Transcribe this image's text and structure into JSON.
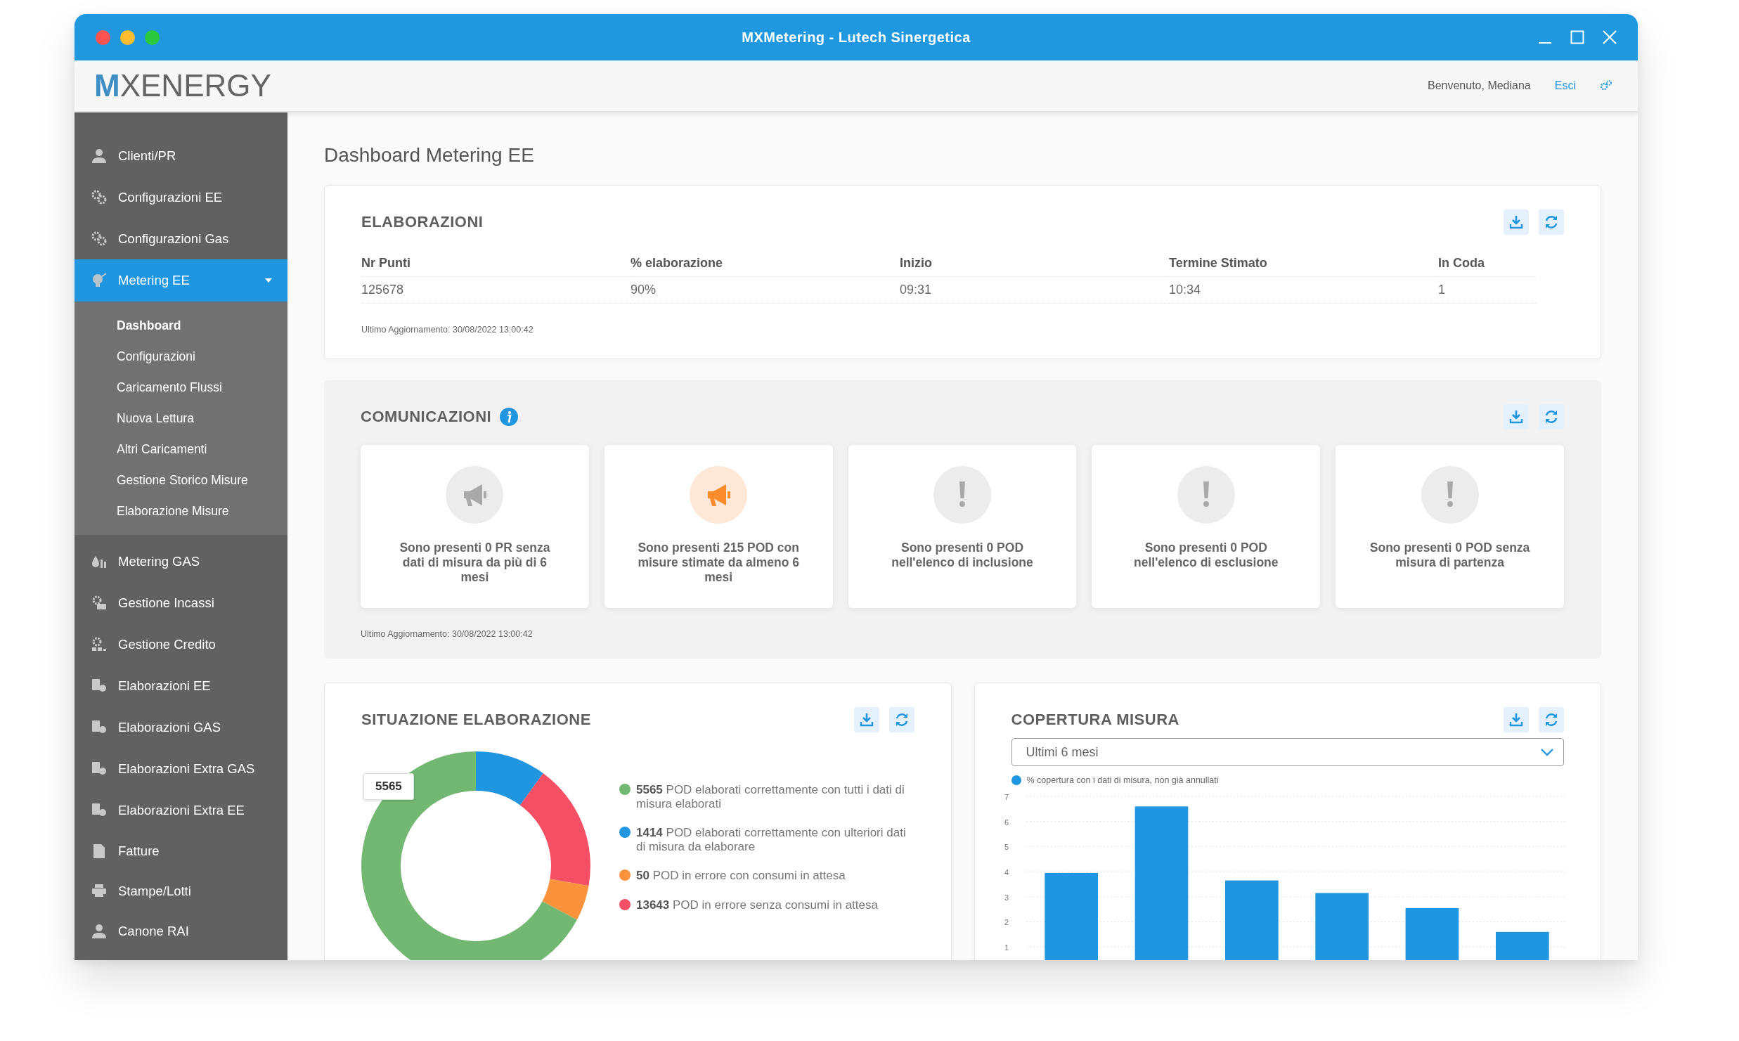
{
  "window": {
    "title": "MXMetering - Lutech Sinergetica"
  },
  "header": {
    "logo": {
      "mark": "M",
      "text": "XENERGY"
    },
    "welcome": "Benvenuto, Mediana",
    "logout": "Esci"
  },
  "sidebar": {
    "items": [
      {
        "label": "Clienti/PR",
        "selected": false
      },
      {
        "label": "Configurazioni EE",
        "selected": false
      },
      {
        "label": "Configurazioni Gas",
        "selected": false
      },
      {
        "label": "Metering EE",
        "selected": true,
        "expanded": true,
        "children": [
          {
            "label": "Dashboard",
            "selected": true
          },
          {
            "label": "Configurazioni",
            "selected": false
          },
          {
            "label": "Caricamento Flussi",
            "selected": false
          },
          {
            "label": "Nuova Lettura",
            "selected": false
          },
          {
            "label": "Altri Caricamenti",
            "selected": false
          },
          {
            "label": "Gestione Storico Misure",
            "selected": false
          },
          {
            "label": "Elaborazione Misure",
            "selected": false
          }
        ]
      },
      {
        "label": "Metering GAS",
        "selected": false
      },
      {
        "label": "Gestione Incassi",
        "selected": false
      },
      {
        "label": "Gestione Credito",
        "selected": false
      },
      {
        "label": "Elaborazioni EE",
        "selected": false
      },
      {
        "label": "Elaborazioni GAS",
        "selected": false
      },
      {
        "label": "Elaborazioni Extra GAS",
        "selected": false
      },
      {
        "label": "Elaborazioni Extra EE",
        "selected": false
      },
      {
        "label": "Fatture",
        "selected": false
      },
      {
        "label": "Stampe/Lotti",
        "selected": false
      },
      {
        "label": "Canone RAI",
        "selected": false
      }
    ]
  },
  "page_title": "Dashboard Metering EE",
  "elaborazioni": {
    "title": "ELABORAZIONI",
    "table": {
      "columns": [
        "Nr Punti",
        "% elaborazione",
        "Inizio",
        "Termine Stimato",
        "In Coda"
      ],
      "rows": [
        [
          "125678",
          "90%",
          "09:31",
          "10:34",
          "1"
        ]
      ]
    },
    "updated": "Ultimo Aggiornamento: 30/08/2022 13:00:42"
  },
  "comunicazioni": {
    "title": "COMUNICAZIONI",
    "cards": [
      {
        "kind": "megaphone",
        "active": false,
        "text": "Sono presenti 0 PR senza dati di misura da più di 6 mesi"
      },
      {
        "kind": "megaphone",
        "active": true,
        "text": "Sono presenti 215 POD con misure stimate da almeno 6 mesi"
      },
      {
        "kind": "alert",
        "active": false,
        "text": "Sono presenti 0 POD nell'elenco di inclusione"
      },
      {
        "kind": "alert",
        "active": false,
        "text": "Sono presenti 0 POD nell'elenco di esclusione"
      },
      {
        "kind": "alert",
        "active": false,
        "text": "Sono presenti 0 POD senza misura di partenza"
      }
    ],
    "updated": "Ultimo Aggiornamento: 30/08/2022 13:00:42"
  },
  "situazione": {
    "title": "SITUAZIONE ELABORAZIONE",
    "tooltip": "5565",
    "legend": [
      {
        "text": "**5565** POD elaborati correttamente con tutti i dati di misura elaborati",
        "color": "#72b872"
      },
      {
        "text": "**1414** POD elaborati correttamente con ulteriori dati di misura da elaborare",
        "color": "#2196e0"
      },
      {
        "text": "**50** POD in errore con consumi in attesa",
        "color": "#fb923c"
      },
      {
        "text": "**13643** POD in errore senza consumi in attesa",
        "color": "#f54f66"
      }
    ]
  },
  "copertura": {
    "title": "COPERTURA MISURA",
    "period": "Ultimi 6 mesi",
    "chart_data": {
      "type": "bar",
      "grid": true,
      "ylim": [
        0,
        7
      ],
      "yticks": [
        1,
        2,
        3,
        4,
        5,
        6,
        7
      ],
      "series": [
        {
          "name": "% copertura con i dati di misura, non già annullati",
          "color": "#2196e0",
          "values": [
            3.95,
            6.6,
            3.65,
            3.15,
            2.55,
            1.6
          ]
        }
      ]
    }
  }
}
